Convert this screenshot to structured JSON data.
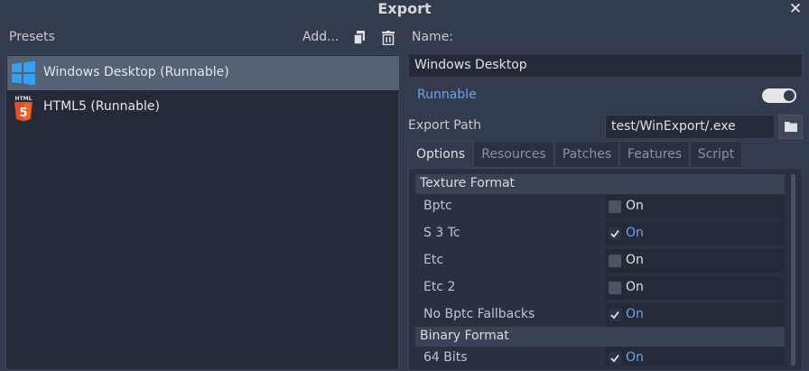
{
  "window": {
    "title": "Export",
    "close_icon": "close-icon"
  },
  "presets": {
    "label": "Presets",
    "add_label": "Add...",
    "items": [
      {
        "label": "Windows Desktop (Runnable)",
        "icon": "windows-icon",
        "selected": true
      },
      {
        "label": "HTML5 (Runnable)",
        "icon": "html5-icon",
        "selected": false
      }
    ]
  },
  "details": {
    "name_label": "Name:",
    "name_value": "Windows Desktop",
    "runnable_label": "Runnable",
    "runnable_on": true,
    "export_path_label": "Export Path",
    "export_path_value": "test/WinExport/.exe",
    "tabs": [
      "Options",
      "Resources",
      "Patches",
      "Features",
      "Script"
    ],
    "active_tab": "Options"
  },
  "options": {
    "sections": [
      {
        "title": "Texture Format",
        "props": [
          {
            "label": "Bptc",
            "value": "On",
            "checked": false
          },
          {
            "label": "S 3 Tc",
            "value": "On",
            "checked": true
          },
          {
            "label": "Etc",
            "value": "On",
            "checked": false
          },
          {
            "label": "Etc 2",
            "value": "On",
            "checked": false
          },
          {
            "label": "No Bptc Fallbacks",
            "value": "On",
            "checked": true
          }
        ]
      },
      {
        "title": "Binary Format",
        "props": [
          {
            "label": "64 Bits",
            "value": "On",
            "checked": true
          }
        ]
      }
    ]
  },
  "colors": {
    "accent": "#6fa3e6",
    "background": "#333b4f",
    "selected": "#566176"
  }
}
